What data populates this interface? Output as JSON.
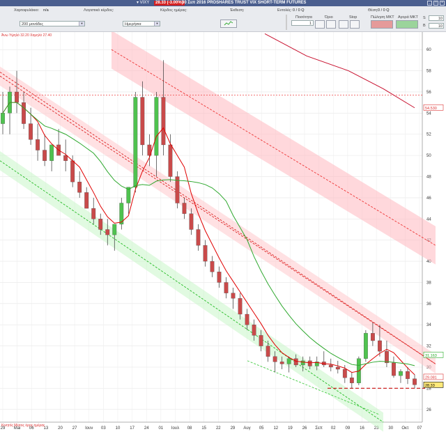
{
  "titlebar": {
    "symbol": "▾ VIXY",
    "change": "28.33 (-3.00%)",
    "name": "30 Σεπ 2016 PROSHARES TRUST VIX SHORT-TERM FUTURES"
  },
  "toolbar": {
    "portfolio_label": "Χαρτοφυλάκιο:",
    "portfolio_value": "n/a",
    "profit_label": "Λογιστικό κέρδος:",
    "day_profit_label": "Κέρδος ημέρας:",
    "exposure_label": "Έκθεση:",
    "orders_label": "Εντολές:",
    "orders_value": "0 / 0 Q",
    "position_label": "Θέση:",
    "position_value": "0 / 0 Q",
    "amount_select": "200 μονάδες",
    "period_select": "Ημερήσια",
    "qty_label": "Ποσότητα",
    "qty_value": "1",
    "limit_label": "Όριο",
    "stop_label": "Stop",
    "sell_mkt_label": "Πώληση ΜΚΤ",
    "buy_mkt_label": "Αγορά ΜΚΤ",
    "s_label": "S",
    "b_label": "B",
    "s_val": "10",
    "b_val": "10"
  },
  "chart_annotations": {
    "top_left": "Άνω Υψηλό 32.20 Χαμηλό 27.40",
    "bottom_left": "Κινητός Μέσος όρος ημέρας"
  },
  "chart_data": {
    "type": "candlestick",
    "y_ticks": [
      "60",
      "58",
      "56",
      "54",
      "52",
      "50",
      "48",
      "46",
      "44",
      "42",
      "40",
      "38",
      "36",
      "34",
      "32",
      "30",
      "28",
      "26"
    ],
    "ylim": [
      24.8,
      61
    ],
    "x_ticks": [
      "29",
      "Mai",
      "06",
      "13",
      "20",
      "27",
      "Ιουν",
      "03",
      "10",
      "17",
      "24",
      "01",
      "Ιουλ",
      "08",
      "15",
      "22",
      "29",
      "Aυγ",
      "05",
      "12",
      "19",
      "26",
      "Σεπ",
      "02",
      "09",
      "16",
      "23",
      "30",
      "Οκτ",
      "07"
    ],
    "price_tags": {
      "upper_red": "54.530",
      "green_ma": "31.163",
      "red_ma": "29.081",
      "last": "28.33"
    },
    "candles": [
      [
        53,
        56,
        52,
        54
      ],
      [
        54,
        56.5,
        52,
        56
      ],
      [
        56,
        58,
        54,
        55
      ],
      [
        55,
        56,
        52.5,
        53
      ],
      [
        53,
        54.5,
        51,
        51.5
      ],
      [
        51.5,
        53,
        49.5,
        50.5
      ],
      [
        50.5,
        52,
        49,
        49.5
      ],
      [
        49.5,
        51,
        48.5,
        51
      ],
      [
        51,
        52.5,
        50,
        50
      ],
      [
        50,
        51.5,
        48.5,
        49.5
      ],
      [
        49.5,
        50,
        47,
        47.5
      ],
      [
        47.5,
        48.5,
        46,
        46.5
      ],
      [
        46.5,
        47,
        45,
        45
      ],
      [
        45,
        46,
        43.5,
        44
      ],
      [
        44,
        44.5,
        42.5,
        43
      ],
      [
        43,
        44,
        41.5,
        42.5
      ],
      [
        42.5,
        43.5,
        41,
        43.5
      ],
      [
        43.5,
        46,
        43,
        45.5
      ],
      [
        45.5,
        47,
        44.5,
        47
      ],
      [
        47,
        56,
        46.5,
        55.5
      ],
      [
        55.5,
        57,
        50,
        51
      ],
      [
        51,
        52,
        49,
        50
      ],
      [
        50,
        56,
        48,
        55.5
      ],
      [
        55.5,
        59,
        50,
        51
      ],
      [
        51,
        52,
        47.5,
        48
      ],
      [
        48,
        48.5,
        45,
        45.5
      ],
      [
        45.5,
        46,
        44,
        44.5
      ],
      [
        44.5,
        45,
        42.5,
        43
      ],
      [
        43,
        43.5,
        41,
        41.5
      ],
      [
        41.5,
        42,
        39.5,
        40
      ],
      [
        40,
        40.5,
        38.5,
        39
      ],
      [
        39,
        39.5,
        37.5,
        38
      ],
      [
        38,
        38.5,
        36.5,
        37
      ],
      [
        37,
        37.5,
        35.5,
        36.5
      ],
      [
        36.5,
        37,
        34.5,
        35
      ],
      [
        35,
        35.5,
        33.5,
        34
      ],
      [
        34,
        34.5,
        32.5,
        33
      ],
      [
        33,
        33.5,
        31.5,
        32
      ],
      [
        32,
        32.5,
        30.5,
        31
      ],
      [
        31,
        31.5,
        29.5,
        30.5
      ],
      [
        30.5,
        31,
        29.8,
        30.3
      ],
      [
        30.3,
        31,
        29.5,
        30.8
      ],
      [
        30.8,
        31.2,
        30,
        30.2
      ],
      [
        30.2,
        31,
        29.6,
        30.6
      ],
      [
        30.6,
        31,
        29.8,
        30.1
      ],
      [
        30.1,
        31,
        29.7,
        30.5
      ],
      [
        30.5,
        31.5,
        30,
        30.2
      ],
      [
        30.2,
        30.8,
        29.6,
        30
      ],
      [
        30,
        30.6,
        29.4,
        29.8
      ],
      [
        29.8,
        30.2,
        28.5,
        29
      ],
      [
        29,
        29.5,
        28,
        28.5
      ],
      [
        28.5,
        31,
        28.3,
        30.8
      ],
      [
        30.8,
        33.5,
        30.5,
        33.2
      ],
      [
        33.2,
        34.2,
        32,
        32.5
      ],
      [
        32.5,
        34,
        31,
        31.5
      ],
      [
        31.5,
        32.5,
        30,
        30.4
      ],
      [
        30.4,
        31,
        29,
        29.2
      ],
      [
        29.2,
        29.8,
        28.5,
        29.6
      ],
      [
        29.6,
        30,
        28.4,
        28.9
      ],
      [
        28.9,
        29.3,
        28,
        28.33
      ]
    ]
  }
}
